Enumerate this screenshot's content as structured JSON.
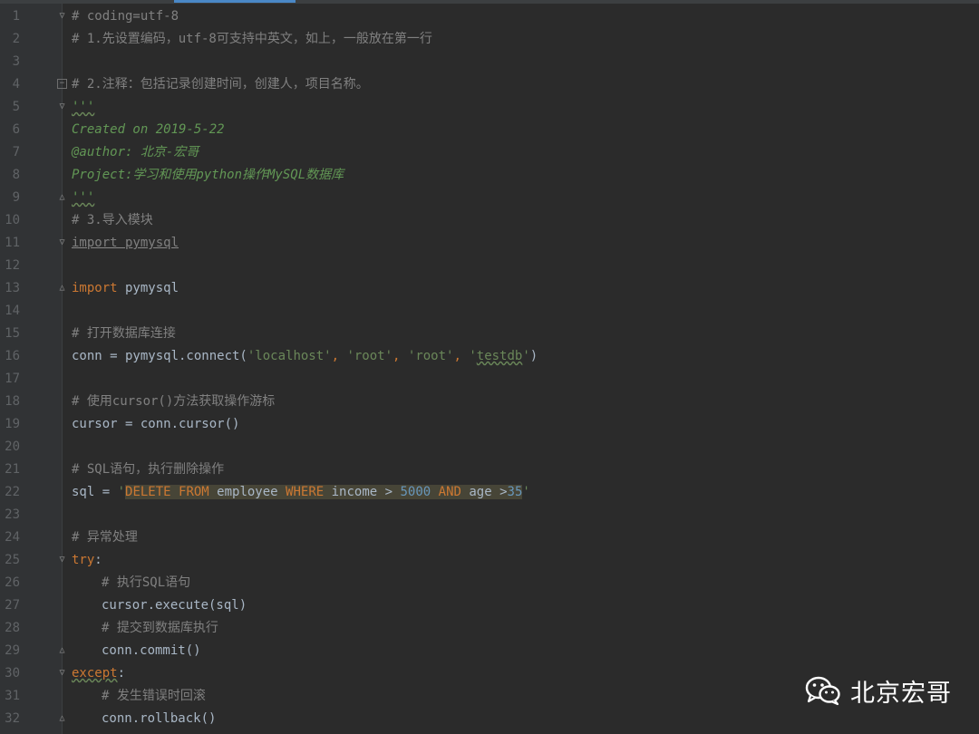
{
  "editor": {
    "lines": [
      {
        "n": "1",
        "segments": [
          {
            "t": "# coding=utf-8",
            "c": "c-comment"
          }
        ]
      },
      {
        "n": "2",
        "segments": [
          {
            "t": "# 1.先设置编码，utf-8可支持中英文，如上，一般放在第一行",
            "c": "c-comment"
          }
        ]
      },
      {
        "n": "3",
        "segments": []
      },
      {
        "n": "4",
        "segments": [
          {
            "t": "# 2.注释：包括记录创建时间，创建人，项目名称。",
            "c": "c-comment"
          }
        ]
      },
      {
        "n": "5",
        "segments": [
          {
            "t": "'''",
            "c": "c-doc squig"
          }
        ]
      },
      {
        "n": "6",
        "segments": [
          {
            "t": "Created on 2019-5-22",
            "c": "c-doc"
          }
        ]
      },
      {
        "n": "7",
        "segments": [
          {
            "t": "@author: 北京-宏哥",
            "c": "c-doc"
          }
        ]
      },
      {
        "n": "8",
        "segments": [
          {
            "t": "Project:学习和使用python操作MySQL数据库",
            "c": "c-doc"
          }
        ]
      },
      {
        "n": "9",
        "segments": [
          {
            "t": "'''",
            "c": "c-doc squig"
          }
        ]
      },
      {
        "n": "10",
        "segments": [
          {
            "t": "# 3.导入模块",
            "c": "c-comment"
          }
        ]
      },
      {
        "n": "11",
        "segments": [
          {
            "t": "import pymysql",
            "c": "c-comment under"
          }
        ]
      },
      {
        "n": "12",
        "segments": []
      },
      {
        "n": "13",
        "segments": [
          {
            "t": "import",
            "c": "c-kw"
          },
          {
            "t": " pymysql",
            "c": "c-plain"
          }
        ]
      },
      {
        "n": "14",
        "segments": []
      },
      {
        "n": "15",
        "segments": [
          {
            "t": "# 打开数据库连接",
            "c": "c-comment"
          }
        ]
      },
      {
        "n": "16",
        "segments": [
          {
            "t": "conn = pymysql.connect(",
            "c": "c-plain"
          },
          {
            "t": "'localhost'",
            "c": "c-str"
          },
          {
            "t": ", ",
            "c": "c-kw"
          },
          {
            "t": "'root'",
            "c": "c-str"
          },
          {
            "t": ", ",
            "c": "c-kw"
          },
          {
            "t": "'root'",
            "c": "c-str"
          },
          {
            "t": ", ",
            "c": "c-kw"
          },
          {
            "t": "'",
            "c": "c-str"
          },
          {
            "t": "testdb",
            "c": "c-str squig"
          },
          {
            "t": "'",
            "c": "c-str"
          },
          {
            "t": ")",
            "c": "c-plain"
          }
        ]
      },
      {
        "n": "17",
        "segments": []
      },
      {
        "n": "18",
        "segments": [
          {
            "t": "# 使用cursor()方法获取操作游标",
            "c": "c-comment"
          }
        ]
      },
      {
        "n": "19",
        "segments": [
          {
            "t": "cursor = conn.cursor()",
            "c": "c-plain"
          }
        ]
      },
      {
        "n": "20",
        "segments": []
      },
      {
        "n": "21",
        "segments": [
          {
            "t": "# SQL语句，执行删除操作",
            "c": "c-comment"
          }
        ]
      },
      {
        "n": "22",
        "segments": [
          {
            "t": "sql = ",
            "c": "c-plain"
          },
          {
            "t": "'",
            "c": "c-str"
          },
          {
            "t": "DELETE FROM",
            "c": "c-sql-kw hl"
          },
          {
            "t": " employee ",
            "c": "c-plain hl"
          },
          {
            "t": "WHERE",
            "c": "c-sql-kw hl"
          },
          {
            "t": " income > ",
            "c": "c-plain hl"
          },
          {
            "t": "5000",
            "c": "c-num hl"
          },
          {
            "t": " ",
            "c": "c-plain hl"
          },
          {
            "t": "AND",
            "c": "c-sql-kw hl"
          },
          {
            "t": " age >",
            "c": "c-plain hl"
          },
          {
            "t": "35",
            "c": "c-num hl"
          },
          {
            "t": "'",
            "c": "c-str"
          }
        ]
      },
      {
        "n": "23",
        "segments": []
      },
      {
        "n": "24",
        "segments": [
          {
            "t": "# 异常处理",
            "c": "c-comment"
          }
        ]
      },
      {
        "n": "25",
        "segments": [
          {
            "t": "try",
            "c": "c-kw"
          },
          {
            "t": ":",
            "c": "c-plain"
          }
        ]
      },
      {
        "n": "26",
        "indent": true,
        "segments": [
          {
            "t": "# 执行SQL语句",
            "c": "c-comment"
          }
        ]
      },
      {
        "n": "27",
        "indent": true,
        "segments": [
          {
            "t": "cursor.execute(sql)",
            "c": "c-plain"
          }
        ]
      },
      {
        "n": "28",
        "indent": true,
        "segments": [
          {
            "t": "# 提交到数据库执行",
            "c": "c-comment"
          }
        ]
      },
      {
        "n": "29",
        "indent": true,
        "segments": [
          {
            "t": "conn.commit()",
            "c": "c-plain"
          }
        ]
      },
      {
        "n": "30",
        "segments": [
          {
            "t": "except",
            "c": "c-kw squig"
          },
          {
            "t": ":",
            "c": "c-plain"
          }
        ]
      },
      {
        "n": "31",
        "indent": true,
        "segments": [
          {
            "t": "# 发生错误时回滚",
            "c": "c-comment"
          }
        ]
      },
      {
        "n": "32",
        "indent": true,
        "segments": [
          {
            "t": "conn.rollback()",
            "c": "c-plain"
          }
        ]
      }
    ],
    "folds": {
      "1": "v",
      "4": "box",
      "5": "v",
      "9": "^",
      "11": "v",
      "13": "^",
      "25": "v",
      "29": "^",
      "30": "v",
      "32": "^"
    }
  },
  "watermark": {
    "label": "北京宏哥",
    "icon": "wechat-icon"
  }
}
